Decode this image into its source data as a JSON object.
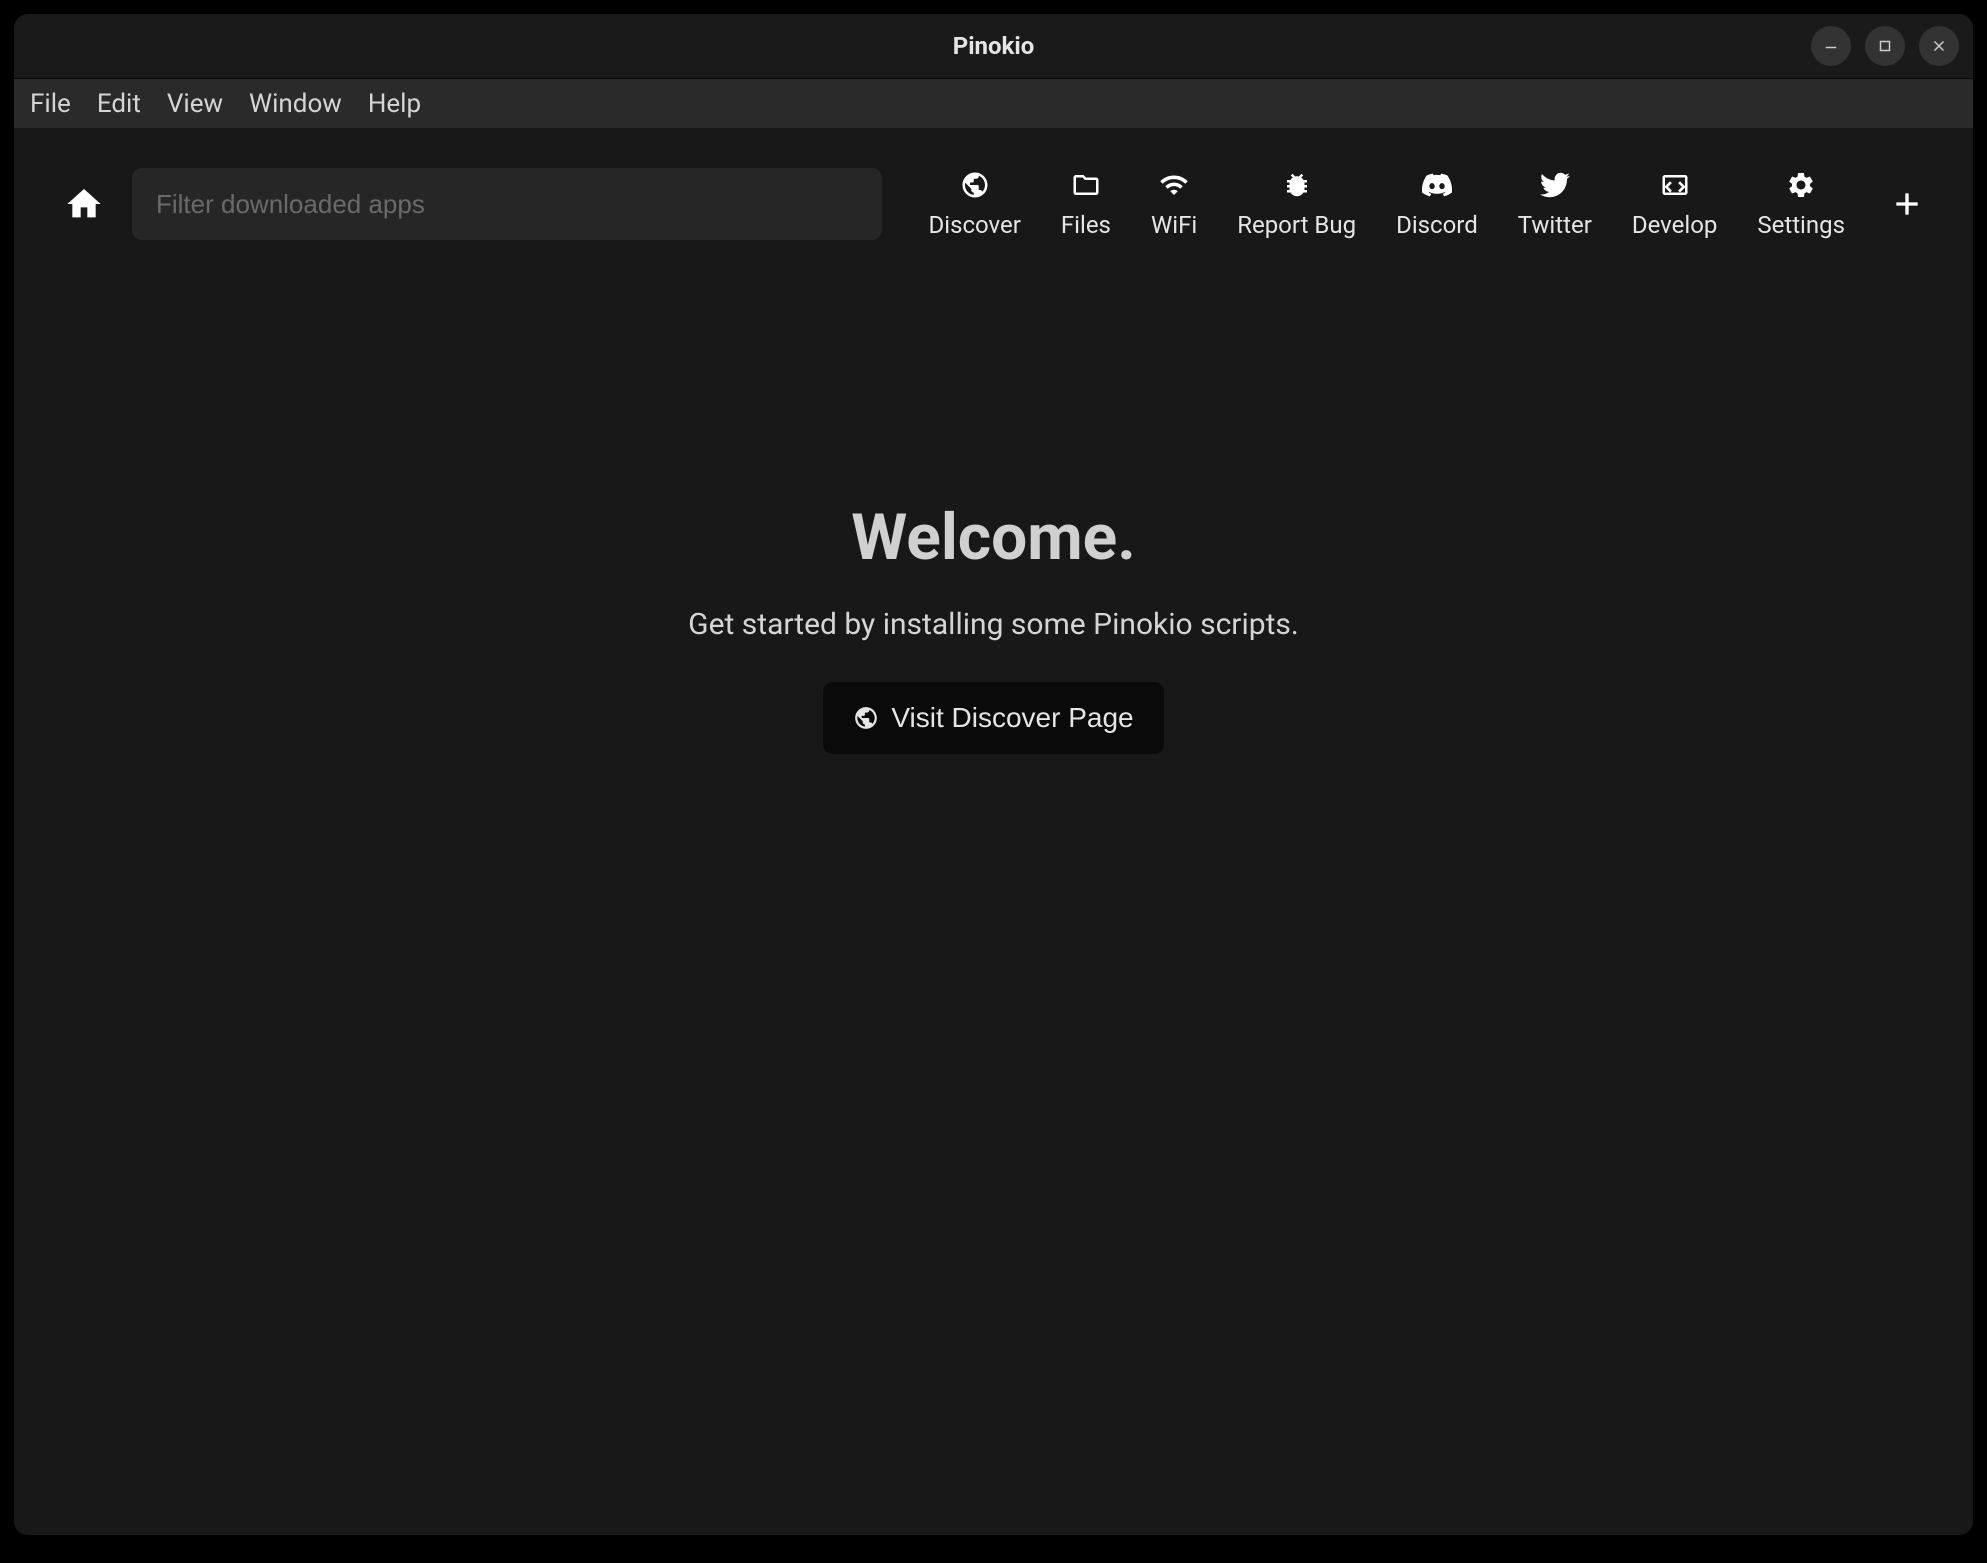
{
  "window": {
    "title": "Pinokio"
  },
  "menubar": {
    "items": [
      "File",
      "Edit",
      "View",
      "Window",
      "Help"
    ]
  },
  "toolbar": {
    "search_placeholder": "Filter downloaded apps",
    "actions": [
      {
        "label": "Discover",
        "icon": "globe-icon"
      },
      {
        "label": "Files",
        "icon": "folder-icon"
      },
      {
        "label": "WiFi",
        "icon": "wifi-icon"
      },
      {
        "label": "Report Bug",
        "icon": "bug-icon"
      },
      {
        "label": "Discord",
        "icon": "discord-icon"
      },
      {
        "label": "Twitter",
        "icon": "twitter-icon"
      },
      {
        "label": "Develop",
        "icon": "code-icon"
      },
      {
        "label": "Settings",
        "icon": "gear-icon"
      }
    ]
  },
  "welcome": {
    "title": "Welcome.",
    "subtitle": "Get started by installing some Pinokio scripts.",
    "button_label": "Visit Discover Page"
  }
}
